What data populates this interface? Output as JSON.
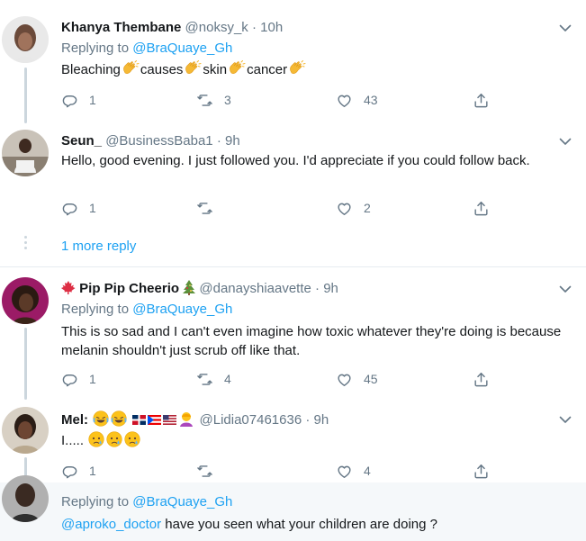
{
  "tweets": [
    {
      "name": "Khanya Thembane",
      "handle": "@noksy_k",
      "time": "· 10h",
      "replying_label": "Replying to",
      "replying_to": "@BraQuaye_Gh",
      "text_parts": [
        "Bleaching",
        "causes",
        "skin",
        "cancer"
      ],
      "reply_count": "1",
      "retweet_count": "3",
      "like_count": "43"
    },
    {
      "name": "Seun_",
      "handle": "@BusinessBaba1",
      "time": "· 9h",
      "text": "Hello, good evening. I just followed you. I'd appreciate if you could follow back.",
      "reply_count": "1",
      "retweet_count": "",
      "like_count": "2",
      "more_replies": "1 more reply"
    },
    {
      "name": "Pip Pip Cheerio",
      "handle": "@danayshiaavette",
      "time": "· 9h",
      "replying_label": "Replying to",
      "replying_to": "@BraQuaye_Gh",
      "text": "This is so sad and I can't even imagine how toxic whatever they're doing is because melanin shouldn't just scrub off like that.",
      "reply_count": "1",
      "retweet_count": "4",
      "like_count": "45"
    },
    {
      "name": "Mel:",
      "handle": "@Lidia07461636",
      "time": "· 9h",
      "text": "I.....",
      "reply_count": "1",
      "retweet_count": "",
      "like_count": "4"
    },
    {
      "replying_label": "Replying to",
      "replying_to": "@BraQuaye_Gh",
      "mention": "@aproko_doctor",
      "text": " have you seen what your children are doing ?"
    }
  ],
  "colors": {
    "accent": "#1da1f2",
    "muted": "#657786",
    "text": "#14171a",
    "divider": "#e6ecf0",
    "thread": "#ccd6dd"
  },
  "icons": [
    "reply-icon",
    "retweet-icon",
    "like-icon",
    "share-icon",
    "chevron-down-icon",
    "clapping-hands-emoji",
    "crying-face-emoji",
    "maple-leaf-emoji",
    "christmas-tree-emoji"
  ]
}
